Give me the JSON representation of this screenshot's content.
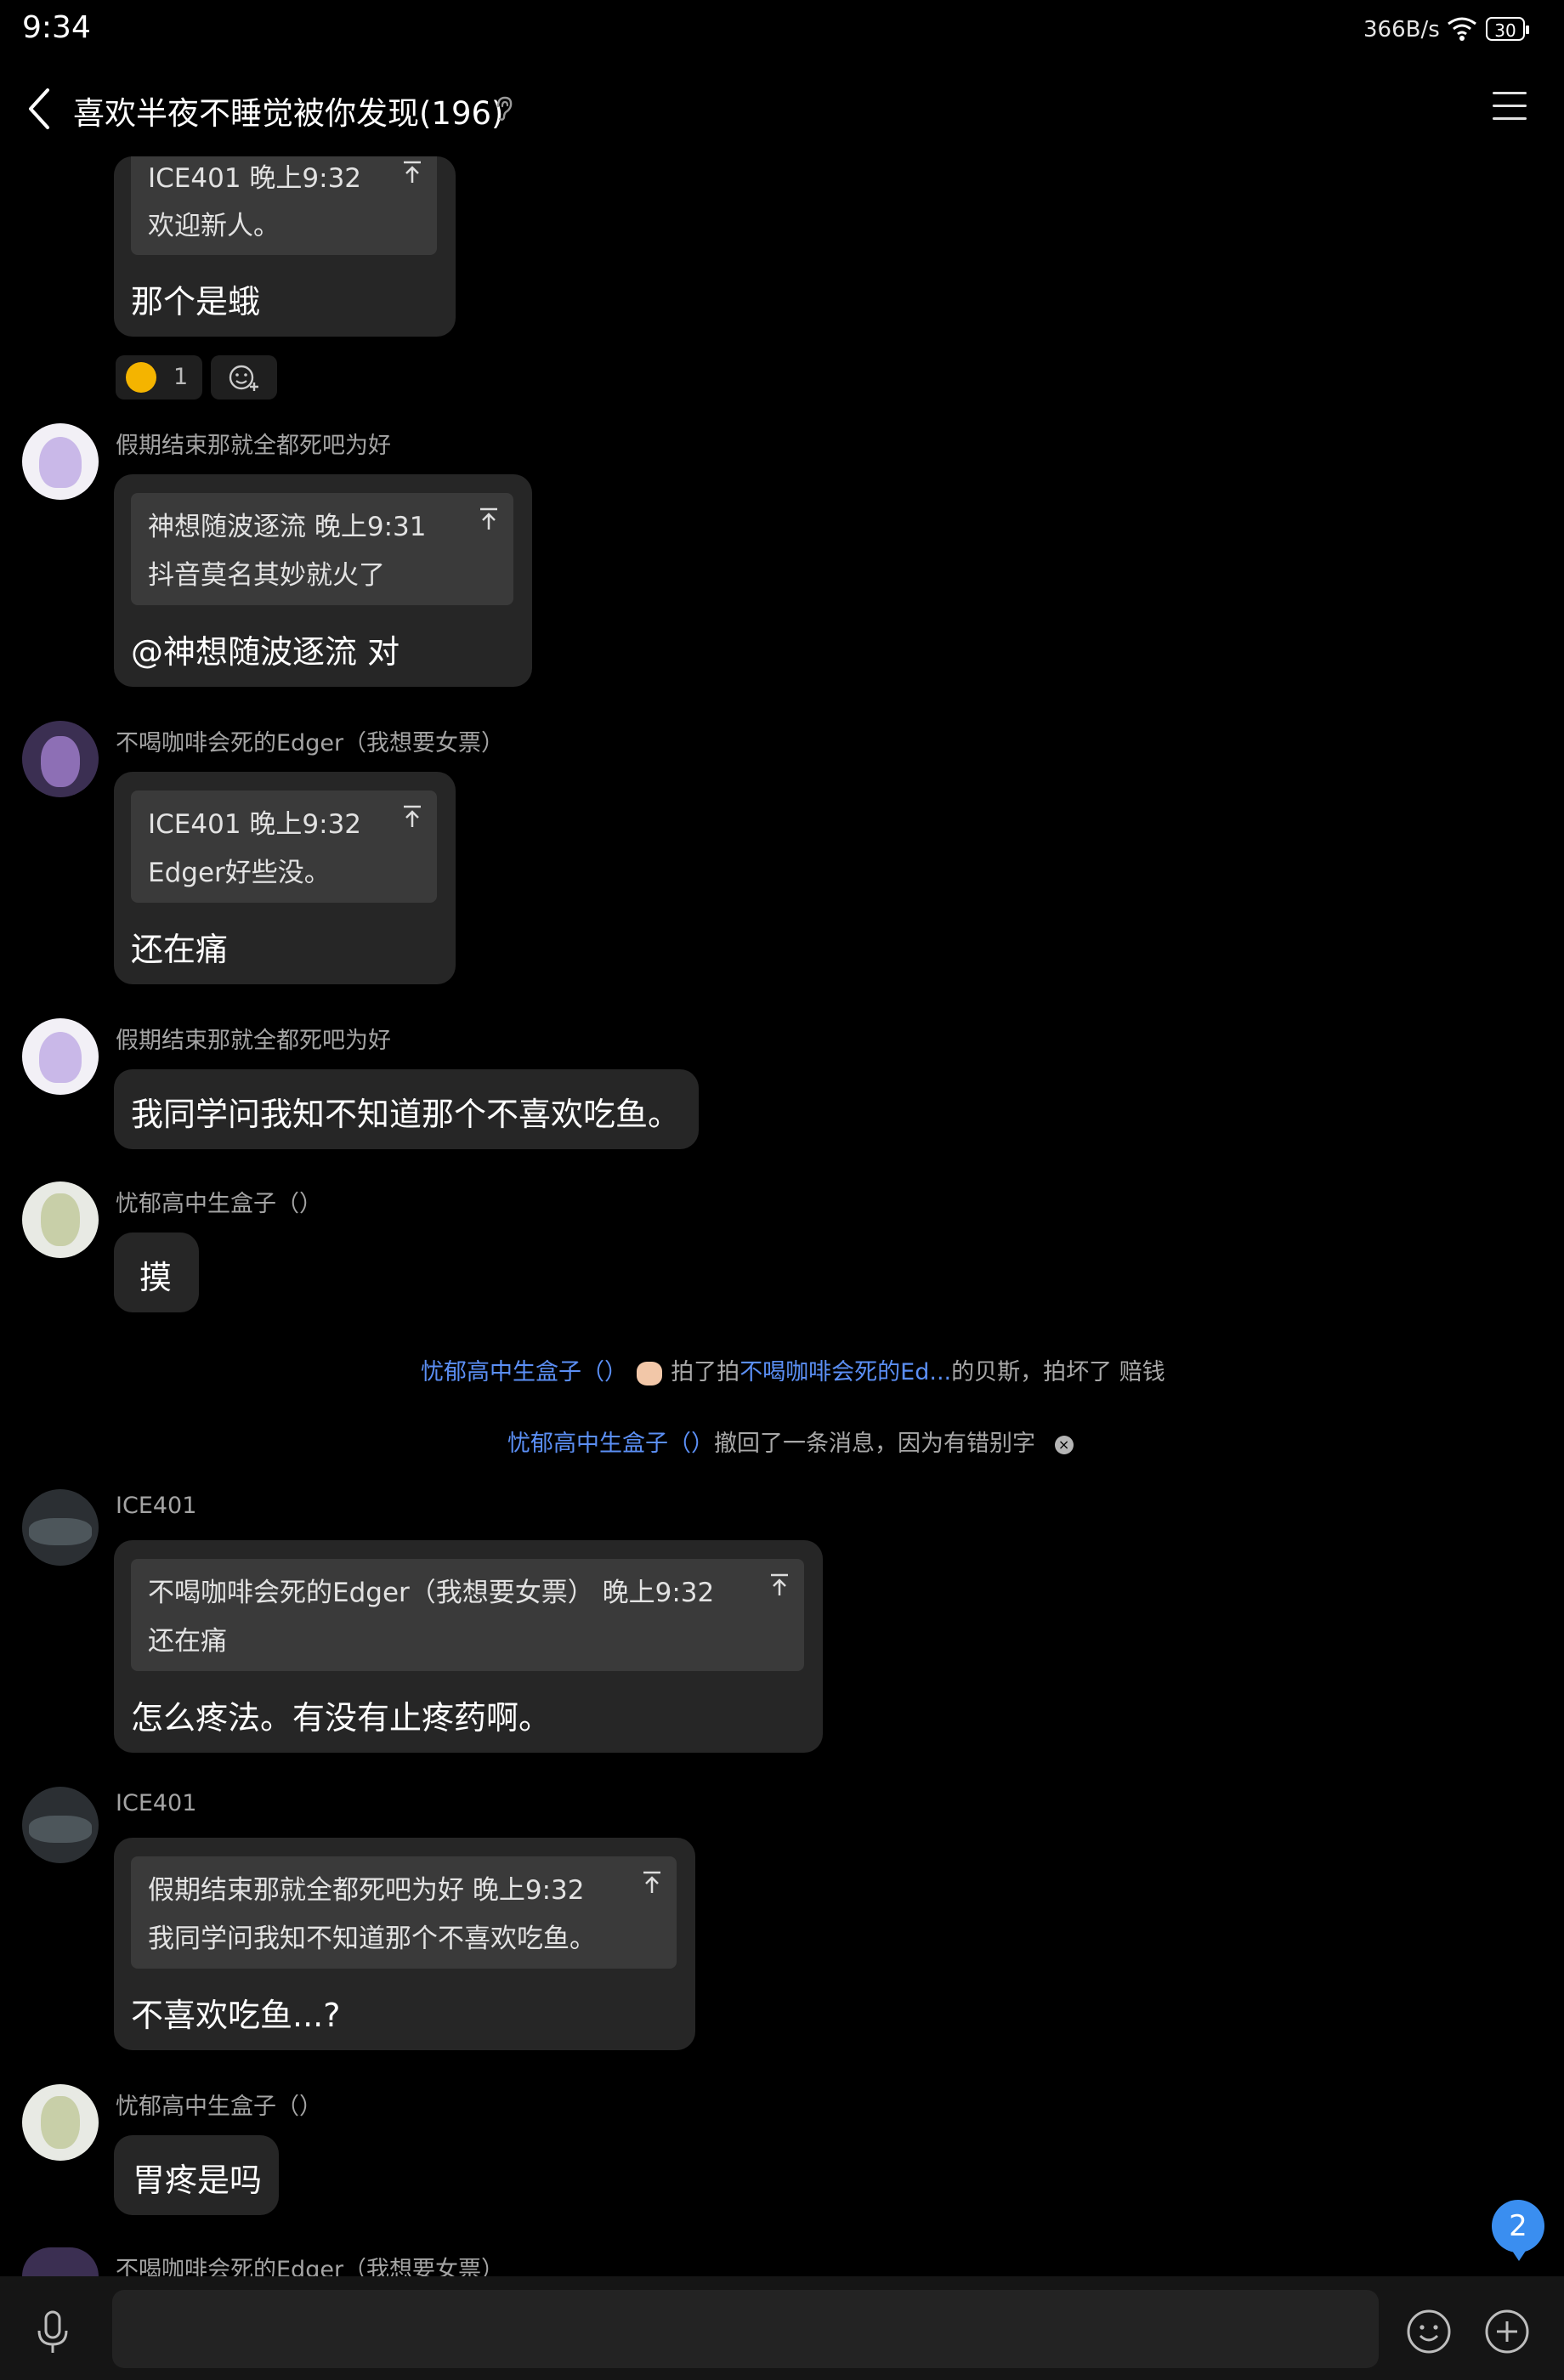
{
  "status": {
    "time": "9:34",
    "net_speed": "366B/s",
    "battery": "30"
  },
  "header": {
    "title": "喜欢半夜不睡觉被你发现(196)"
  },
  "messages": [
    {
      "quote_head": "ICE401 晚上9:32",
      "quote_body": "欢迎新人。",
      "text": "那个是蛾",
      "reaction_count": "1"
    },
    {
      "sender": "假期结束那就全都死吧为好",
      "quote_head": "神想随波逐流 晚上9:31",
      "quote_body": "抖音莫名其妙就火了",
      "text": "@神想随波逐流 对"
    },
    {
      "sender": "不喝咖啡会死的Edger（我想要女票）",
      "quote_head": "ICE401 晚上9:32",
      "quote_body": "Edger好些没。",
      "text": "还在痛"
    },
    {
      "sender": "假期结束那就全都死吧为好",
      "text": "我同学问我知不知道那个不喜欢吃鱼。"
    },
    {
      "sender": "忧郁高中生盒子（）",
      "text": "摸"
    },
    {
      "sender": "ICE401",
      "quote_head": "不喝咖啡会死的Edger（我想要女票） 晚上9:32",
      "quote_body": "还在痛",
      "text": "怎么疼法。有没有止疼药啊。"
    },
    {
      "sender": "ICE401",
      "quote_head": "假期结束那就全都死吧为好 晚上9:32",
      "quote_body": "我同学问我知不知道那个不喜欢吃鱼。",
      "text": "不喜欢吃鱼...?"
    },
    {
      "sender": "忧郁高中生盒子（）",
      "text": "胃疼是吗"
    },
    {
      "sender": "不喝咖啡会死的Edger（我想要女票）"
    }
  ],
  "system": {
    "pat_actor": "忧郁高中生盒子（）",
    "pat_mid": "拍了拍",
    "pat_target": "不喝咖啡会死的Ed...",
    "pat_suffix": "的贝斯，拍坏了 赔钱",
    "recall_actor": "忧郁高中生盒子（）",
    "recall_text": "撤回了一条消息，因为有错别字"
  },
  "unread_badge": "2",
  "icons": [
    "back-arrow-icon",
    "ear-icon",
    "menu-icon",
    "wifi-icon",
    "pin-top-icon",
    "emoji-add-icon",
    "mic-icon",
    "emoji-icon",
    "plus-icon"
  ],
  "colors": {
    "background": "#000000",
    "bubble": "#262626",
    "quote": "#3a3a3a",
    "link": "#5b8ff5",
    "badge": "#3a8ef0"
  }
}
